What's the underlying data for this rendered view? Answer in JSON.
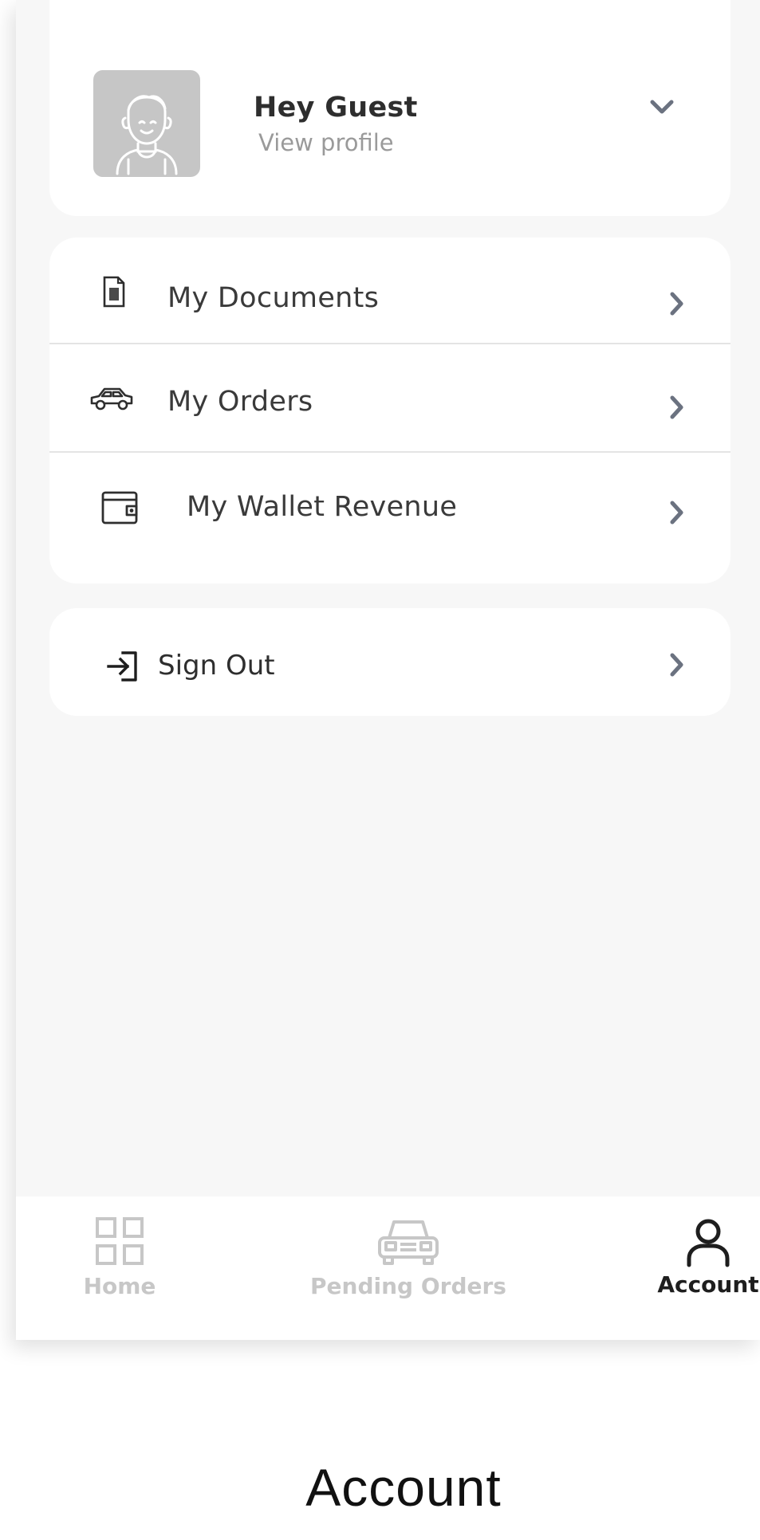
{
  "profile": {
    "greeting": "Hey Guest",
    "subtitle": "View profile"
  },
  "menu": {
    "items": [
      {
        "label": "My Documents",
        "icon": "document-icon"
      },
      {
        "label": "My Orders",
        "icon": "car-icon"
      },
      {
        "label": "My Wallet Revenue",
        "icon": "wallet-icon"
      }
    ]
  },
  "signout": {
    "label": "Sign Out",
    "icon": "sign-in-arrow-icon"
  },
  "nav": {
    "items": [
      {
        "label": "Home",
        "icon": "grid-icon",
        "active": false
      },
      {
        "label": "Pending Orders",
        "icon": "car-icon",
        "active": false
      },
      {
        "label": "Account",
        "icon": "user-icon",
        "active": true
      }
    ]
  },
  "caption": "Account",
  "colors": {
    "background": "#f7f7f7",
    "card": "#ffffff",
    "nav_inactive": "#c7c7c7",
    "nav_active": "#1e1e1e",
    "chevron": "#6b7280"
  }
}
